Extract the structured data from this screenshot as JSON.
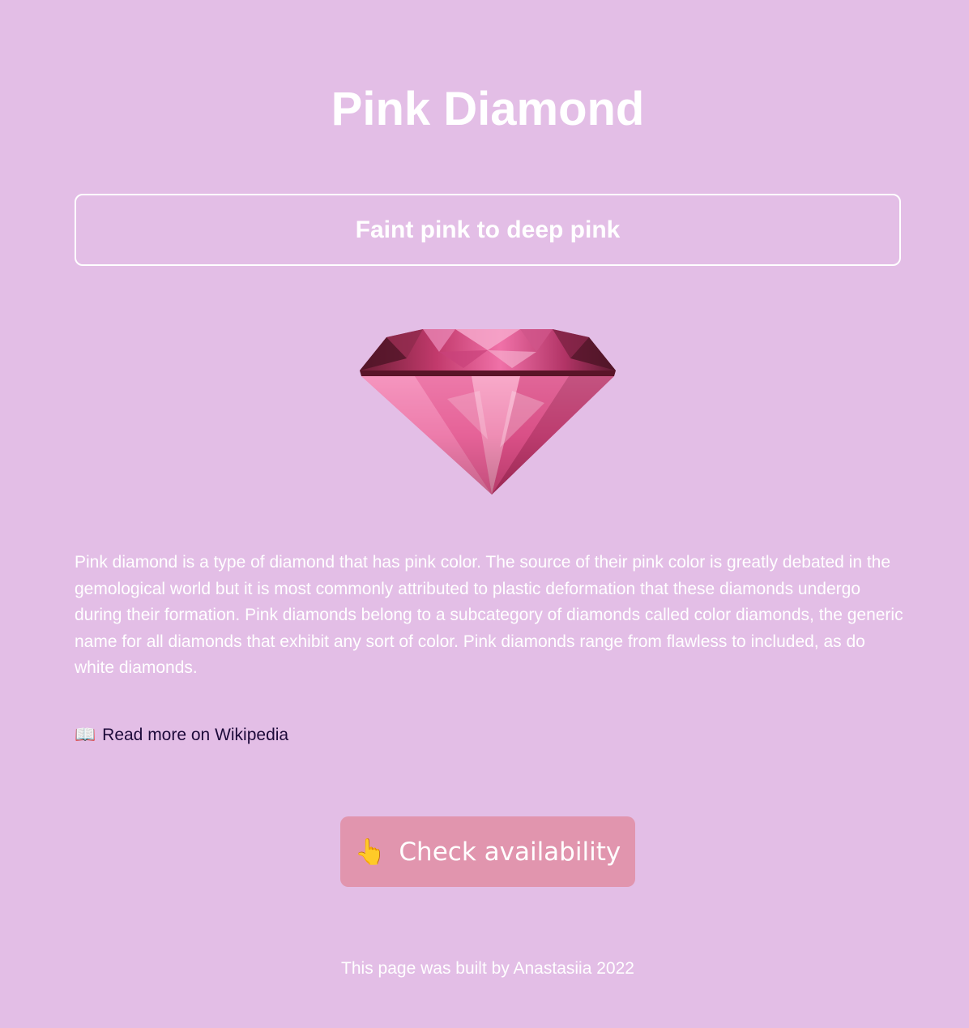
{
  "header": {
    "title": "Pink Diamond"
  },
  "subtitle": {
    "text": "Faint pink to deep pink"
  },
  "image": {
    "icon": "pink-diamond-image"
  },
  "main": {
    "description": "Pink diamond is a type of diamond that has pink color. The source of their pink color is greatly debated in the gemological world but it is most commonly attributed to plastic deformation that these diamonds undergo during their formation. Pink diamonds belong to a subcategory of diamonds called color diamonds, the generic name for all diamonds that exhibit any sort of color. Pink diamonds range from flawless to included, as do white diamonds."
  },
  "link": {
    "icon": "open-book-icon",
    "label": "Read more on Wikipedia"
  },
  "cta": {
    "icon": "pointing-finger-icon",
    "label": "Check availability"
  },
  "footer": {
    "text": "This page was built by Anastasiia 2022"
  },
  "colors": {
    "background": "#e3bee6",
    "button": "#e195ae",
    "link": "#1d0a3a",
    "text": "#ffffff"
  }
}
